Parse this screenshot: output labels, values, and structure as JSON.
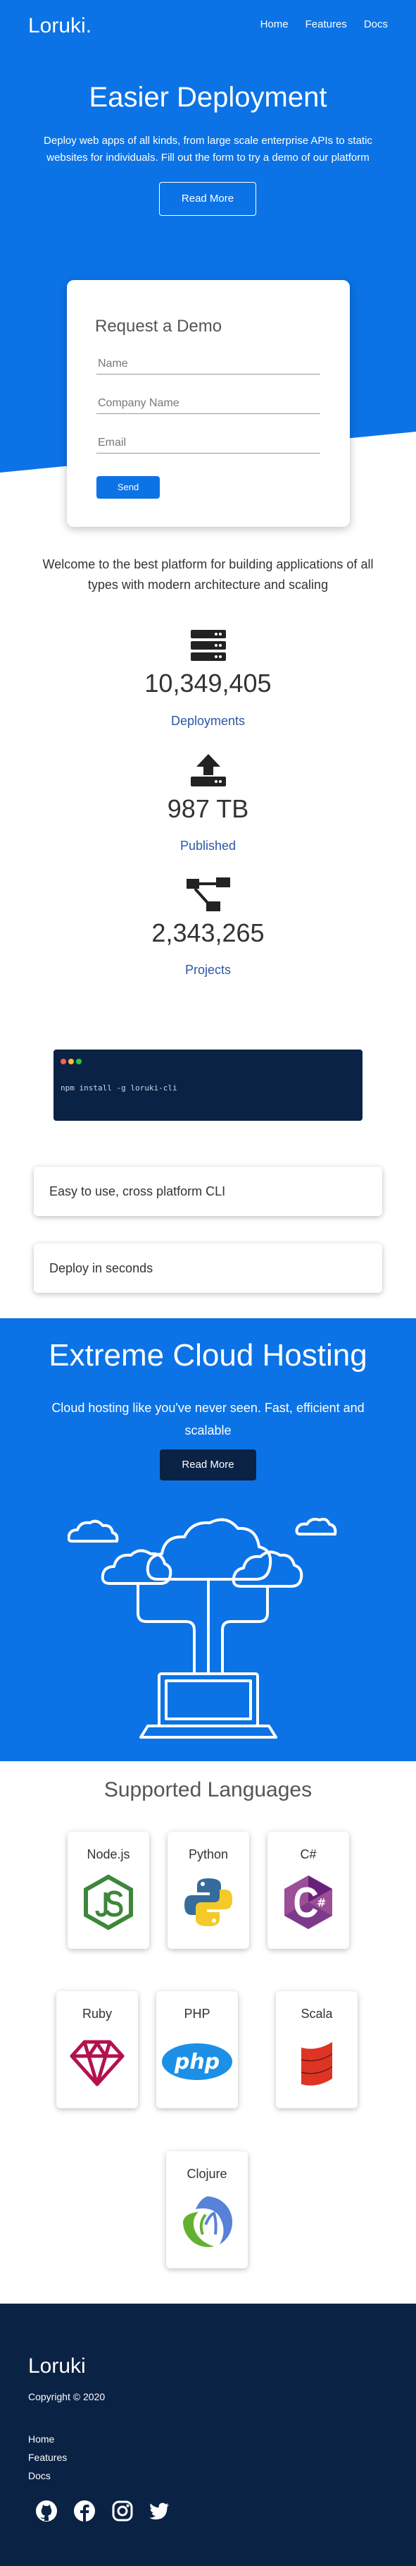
{
  "nav": {
    "brand": "Loruki.",
    "links": [
      "Home",
      "Features",
      "Docs"
    ]
  },
  "hero": {
    "title": "Easier Deployment",
    "subtitle": "Deploy web apps of all kinds, from large scale enterprise APIs to static websites for individuals. Fill out the form to try a demo of our platform",
    "button": "Read More"
  },
  "demo_form": {
    "title": "Request a Demo",
    "fields": [
      {
        "placeholder": "Name"
      },
      {
        "placeholder": "Company Name"
      },
      {
        "placeholder": "Email"
      }
    ],
    "submit": "Send"
  },
  "stats": {
    "intro": "Welcome to the best platform for building applications of all types with modern architecture and scaling",
    "items": [
      {
        "icon": "server-icon",
        "value": "10,349,405",
        "label": "Deployments"
      },
      {
        "icon": "upload-icon",
        "value": "987 TB",
        "label": "Published"
      },
      {
        "icon": "project-diagram-icon",
        "value": "2,343,265",
        "label": "Projects"
      }
    ]
  },
  "cli": {
    "command": "npm install -g loruki-cli",
    "features": [
      "Easy to use, cross platform CLI",
      "Deploy in seconds"
    ],
    "dot_colors": [
      "#ff5f56",
      "#ffbd2e",
      "#27c93f"
    ]
  },
  "cloud": {
    "title": "Extreme Cloud Hosting",
    "subtitle": "Cloud hosting like you've never seen. Fast, efficient and scalable",
    "button": "Read More"
  },
  "languages": {
    "title": "Supported Languages",
    "items": [
      {
        "name": "Node.js",
        "icon": "nodejs-icon"
      },
      {
        "name": "Python",
        "icon": "python-icon"
      },
      {
        "name": "C#",
        "icon": "csharp-icon"
      },
      {
        "name": "Ruby",
        "icon": "ruby-icon"
      },
      {
        "name": "PHP",
        "icon": "php-icon",
        "logo_text": "php"
      },
      {
        "name": "Scala",
        "icon": "scala-icon"
      },
      {
        "name": "Clojure",
        "icon": "clojure-icon"
      }
    ]
  },
  "footer": {
    "brand": "Loruki",
    "copyright": "Copyright © 2020",
    "links": [
      "Home",
      "Features",
      "Docs"
    ],
    "social": [
      "github-icon",
      "facebook-icon",
      "instagram-icon",
      "twitter-icon"
    ]
  },
  "colors": {
    "primary": "#0b73e6",
    "dark": "#0a2244",
    "stat_label": "#2a56a6"
  }
}
